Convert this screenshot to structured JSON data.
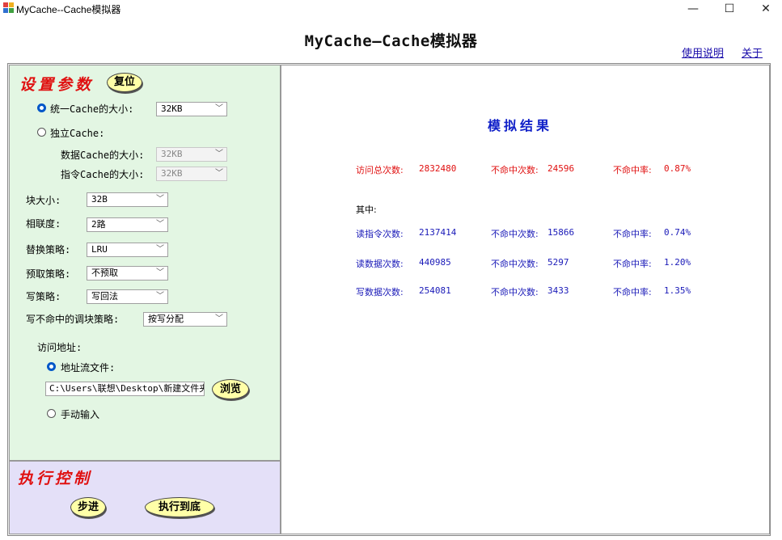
{
  "window": {
    "title": "MyCache--Cache模拟器",
    "minimize": "—",
    "maximize": "☐",
    "close": "✕"
  },
  "heading": "MyCache—Cache模拟器",
  "links": {
    "help": "使用说明",
    "about": "关于"
  },
  "settings": {
    "title": "设置参数",
    "reset_label": "复位",
    "unified_label": "统一Cache的大小:",
    "unified_value": "32KB",
    "split_label": "独立Cache:",
    "data_cache_label": "数据Cache的大小:",
    "data_cache_value": "32KB",
    "inst_cache_label": "指令Cache的大小:",
    "inst_cache_value": "32KB",
    "block_label": "块大小:",
    "block_value": "32B",
    "assoc_label": "相联度:",
    "assoc_value": "2路",
    "replace_label": "替换策略:",
    "replace_value": "LRU",
    "prefetch_label": "预取策略:",
    "prefetch_value": "不预取",
    "write_label": "写策略:",
    "write_value": "写回法",
    "alloc_label": "写不命中的调块策略:",
    "alloc_value": "按写分配",
    "addr_label": "访问地址:",
    "file_label": "地址流文件:",
    "file_value": "C:\\Users\\联想\\Desktop\\新建文件夹\\",
    "browse_label": "浏览",
    "manual_label": "手动输入"
  },
  "exec": {
    "title": "执行控制",
    "step_label": "步进",
    "run_label": "执行到底"
  },
  "results": {
    "title": "模拟结果",
    "total": {
      "label": "访问总次数:",
      "value": "2832480",
      "miss_label": "不命中次数:",
      "miss_value": "24596",
      "rate_label": "不命中率:",
      "rate_value": "0.87%"
    },
    "among": "其中:",
    "rows": [
      {
        "label": "读指令次数:",
        "value": "2137414",
        "miss_label": "不命中次数:",
        "miss_value": "15866",
        "rate_label": "不命中率:",
        "rate_value": "0.74%"
      },
      {
        "label": "读数据次数:",
        "value": "440985",
        "miss_label": "不命中次数:",
        "miss_value": "5297",
        "rate_label": "不命中率:",
        "rate_value": "1.20%"
      },
      {
        "label": "写数据次数:",
        "value": "254081",
        "miss_label": "不命中次数:",
        "miss_value": "3433",
        "rate_label": "不命中率:",
        "rate_value": "1.35%"
      }
    ]
  },
  "colors": {
    "settings_bg": "#e3f6e3",
    "exec_bg": "#e4e0f8",
    "title_red": "#e01010",
    "result_blue": "#1a1ab8",
    "button_yellow": "#ffffa8"
  }
}
